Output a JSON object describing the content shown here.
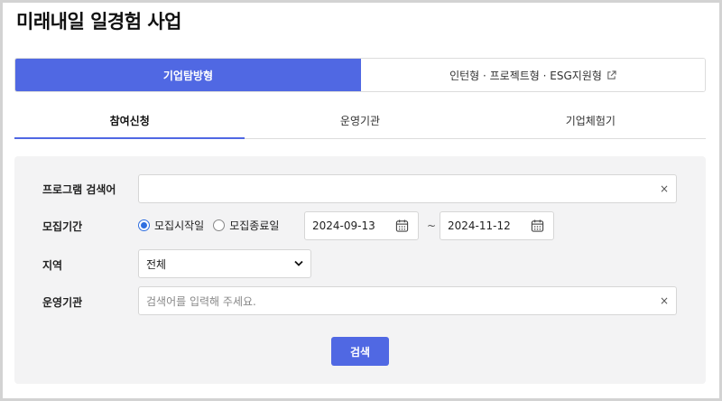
{
  "page": {
    "title": "미래내일 일경험 사업"
  },
  "top_tabs": [
    {
      "label": "기업탐방형",
      "active": true
    },
    {
      "label": "인턴형 · 프로젝트형 · ESG지원형",
      "active": false,
      "icon": "external-link-icon"
    }
  ],
  "sub_tabs": [
    {
      "label": "참여신청",
      "active": true
    },
    {
      "label": "운영기관",
      "active": false
    },
    {
      "label": "기업체험기",
      "active": false
    }
  ],
  "form": {
    "program_search": {
      "label": "프로그램 검색어",
      "value": "",
      "clear": "×"
    },
    "period": {
      "label": "모집기간",
      "options": [
        {
          "label": "모집시작일",
          "checked": true
        },
        {
          "label": "모집종료일",
          "checked": false
        }
      ],
      "start_date": "2024-09-13",
      "end_date": "2024-11-12",
      "separator": "~"
    },
    "region": {
      "label": "지역",
      "selected": "전체"
    },
    "operator": {
      "label": "운영기관",
      "placeholder": "검색어를 입력해 주세요.",
      "clear": "×"
    },
    "search_button": "검색"
  },
  "colors": {
    "accent": "#5068e3",
    "radio": "#2f6fe0",
    "panel_bg": "#f3f3f4"
  }
}
